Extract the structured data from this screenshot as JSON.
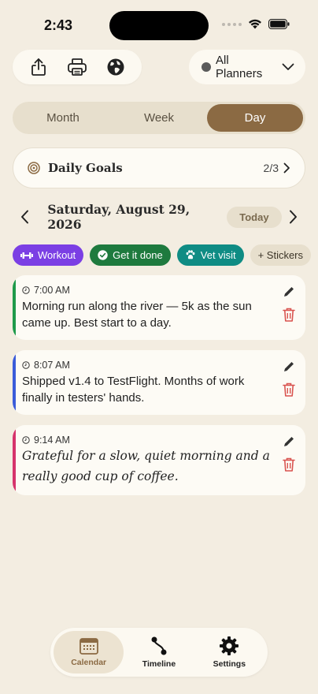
{
  "status": {
    "time": "2:43"
  },
  "toolbar": {
    "icons": [
      "share-icon",
      "printer-icon",
      "globe-icon"
    ],
    "planner_label": "All Planners"
  },
  "segments": [
    {
      "label": "Month",
      "active": false
    },
    {
      "label": "Week",
      "active": false
    },
    {
      "label": "Day",
      "active": true
    }
  ],
  "goals": {
    "title": "Daily Goals",
    "count": "2/3"
  },
  "date": {
    "title": "Saturday, August 29, 2026",
    "today_label": "Today"
  },
  "chips": [
    {
      "label": "Workout",
      "icon": "dumbbell-icon",
      "color": "#7b3fe4"
    },
    {
      "label": "Get it done",
      "icon": "check-badge-icon",
      "color": "#1e7a3e"
    },
    {
      "label": "Vet visit",
      "icon": "paw-icon",
      "color": "#0f8c84"
    },
    {
      "label": "+ Stickers",
      "icon": "",
      "color": "#e7dfcd"
    }
  ],
  "entries": [
    {
      "time": "7:00 AM",
      "text": "Morning run along the river — 5k as the sun came up. Best start to a day.",
      "color": "#1e9a4a"
    },
    {
      "time": "8:07 AM",
      "text": "Shipped v1.4 to TestFlight. Months of work finally in testers' hands.",
      "color": "#3a5bd9"
    },
    {
      "time": "9:14 AM",
      "text": "Grateful for a slow, quiet morning and a really good cup of coffee.",
      "color": "#d6336c"
    }
  ],
  "tabs": [
    {
      "label": "Calendar",
      "icon": "calendar-icon",
      "active": true
    },
    {
      "label": "Timeline",
      "icon": "timeline-icon",
      "active": false
    },
    {
      "label": "Settings",
      "icon": "gear-icon",
      "active": false
    }
  ],
  "colors": {
    "accent": "#8b6a43",
    "background": "#f3ede1",
    "card": "#fdfbf5",
    "delete": "#d9534f"
  }
}
